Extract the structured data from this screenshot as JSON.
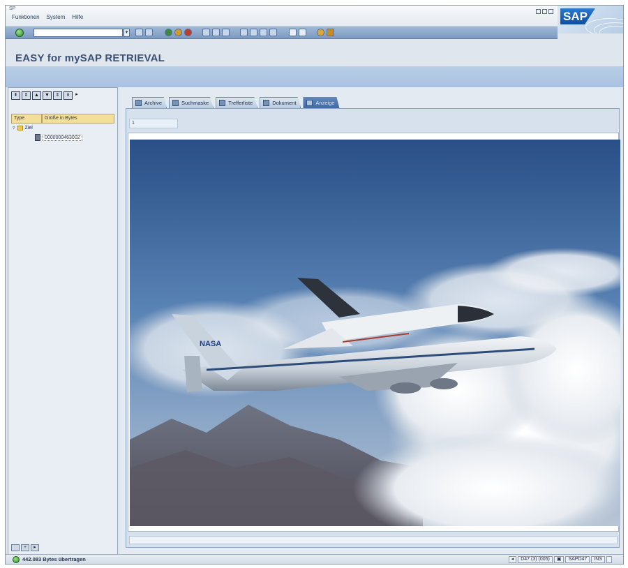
{
  "app": {
    "mark": "SP",
    "logo_text": "SAP"
  },
  "menu": {
    "items": [
      "Funktionen",
      "System",
      "Hilfe"
    ]
  },
  "toolbar": {
    "command_value": ""
  },
  "page": {
    "title": "EASY for mySAP RETRIEVAL"
  },
  "tree": {
    "columns": [
      "Type",
      "Größe in Bytes"
    ],
    "root_label": "Ziel",
    "doc_id": "0000000463002"
  },
  "tabs": [
    {
      "label": "Archive",
      "icon": "archive-icon",
      "active": false
    },
    {
      "label": "Suchmaske",
      "icon": "search-mask-icon",
      "active": false
    },
    {
      "label": "Trefferliste",
      "icon": "hit-list-icon",
      "active": false
    },
    {
      "label": "Dokument",
      "icon": "document-icon",
      "active": false
    },
    {
      "label": "Anzeige",
      "icon": "display-icon",
      "active": true
    }
  ],
  "sub_strip": "1",
  "status": {
    "message": "442.083 Bytes übertragen",
    "system": "D47 (3) (005)",
    "server": "SAPD47",
    "mode": "INS"
  },
  "colors": {
    "toolbar": "#7c9ac0",
    "title_band": "#a8c2e0",
    "tab_active": "#3f6aa5",
    "column_header": "#f3df9a"
  }
}
